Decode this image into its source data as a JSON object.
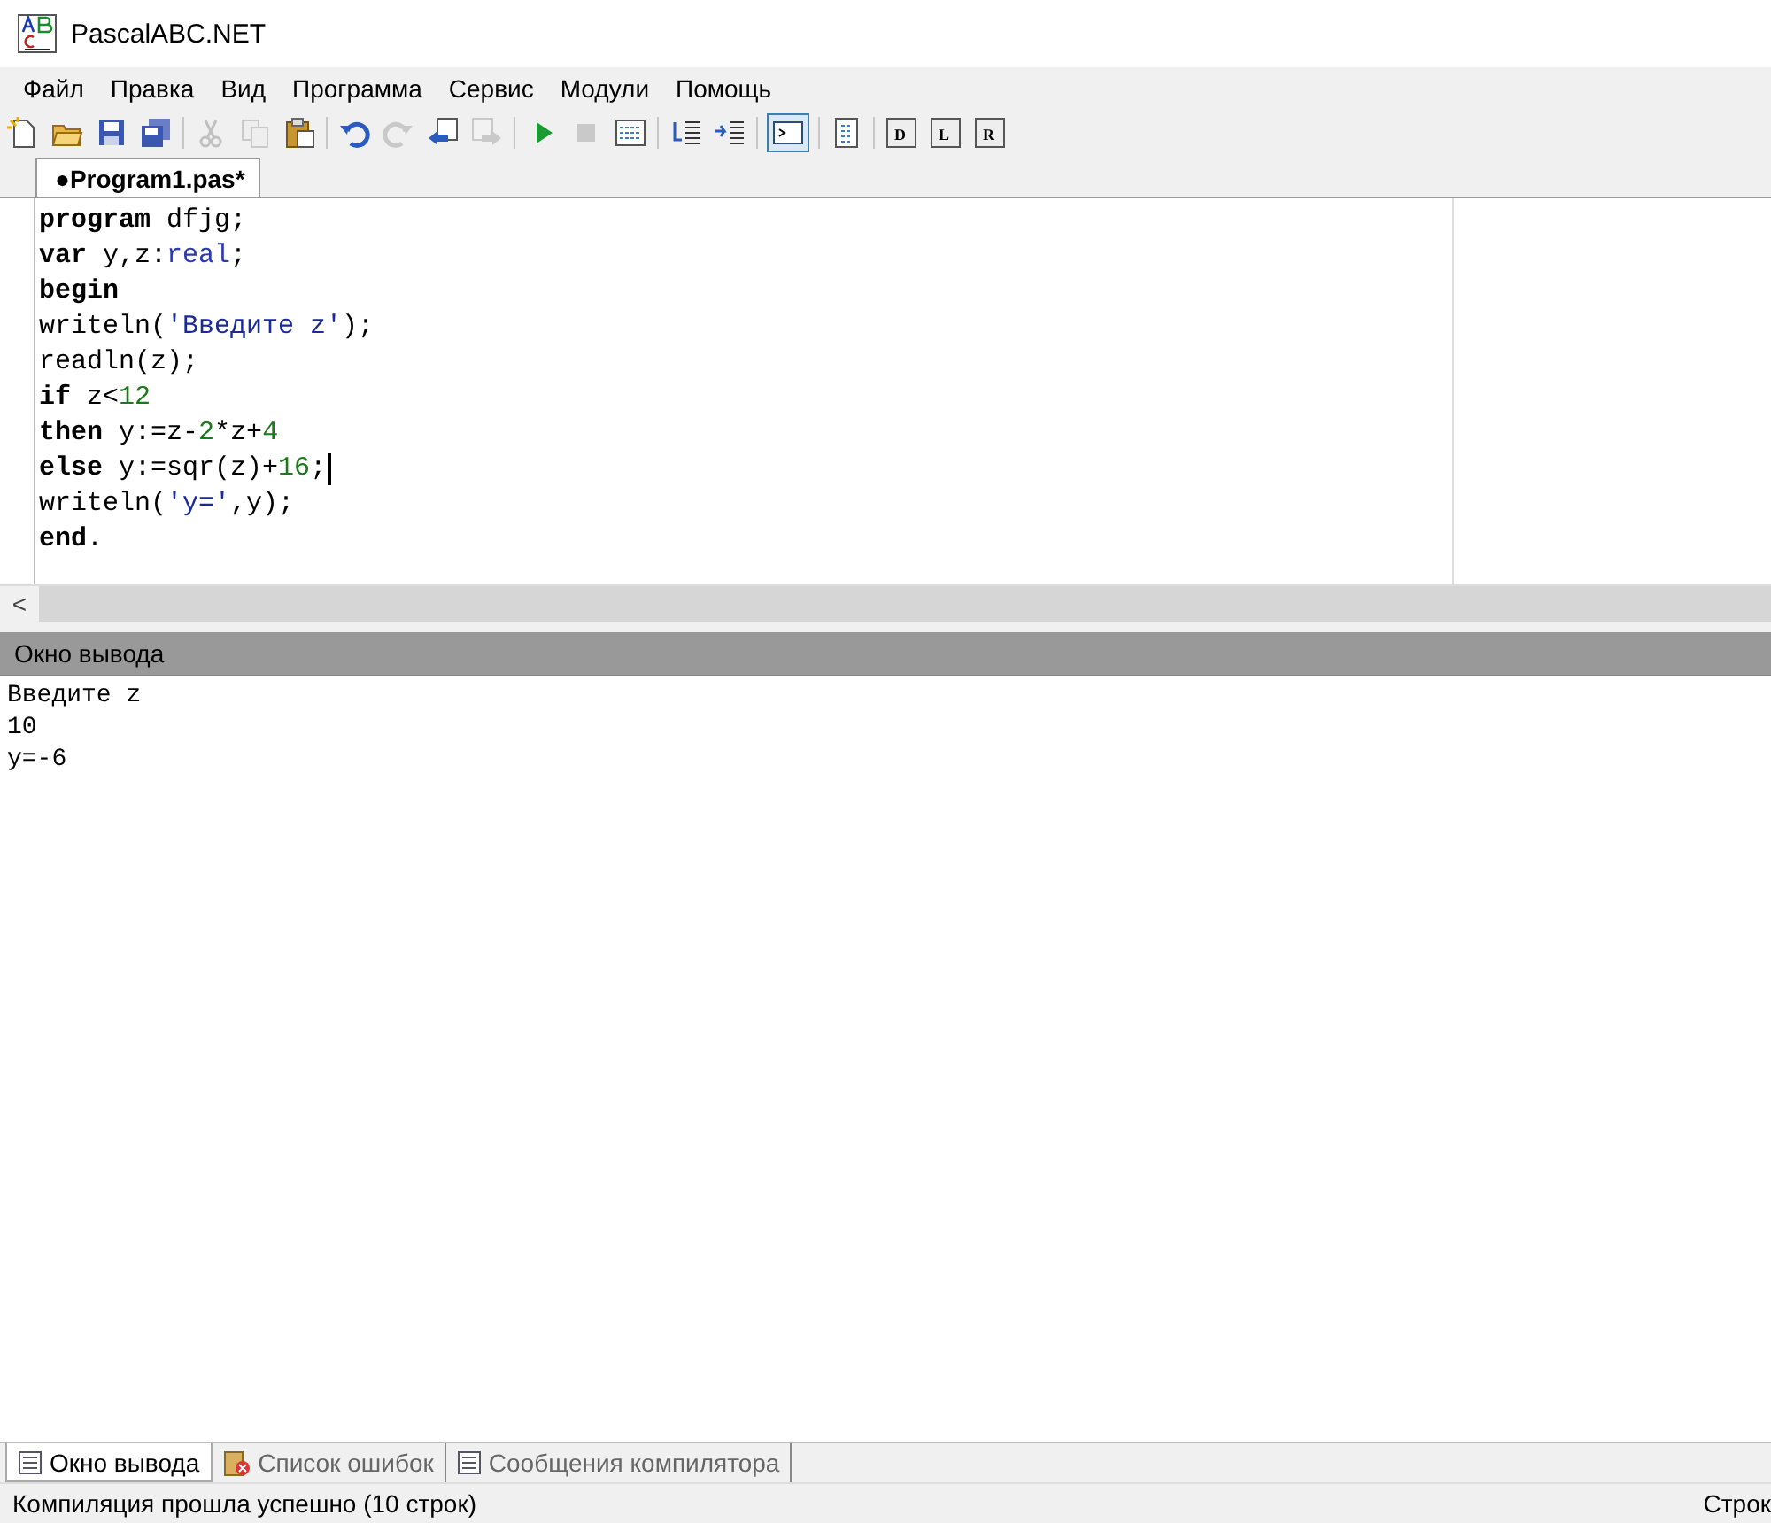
{
  "window": {
    "title": "PascalABC.NET"
  },
  "menu": [
    "Файл",
    "Правка",
    "Вид",
    "Программа",
    "Сервис",
    "Модули",
    "Помощь"
  ],
  "toolbar": [
    {
      "kind": "new",
      "disabled": false,
      "selected": false
    },
    {
      "kind": "open",
      "disabled": false,
      "selected": false
    },
    {
      "kind": "save",
      "disabled": false,
      "selected": false
    },
    {
      "kind": "saveall",
      "disabled": false,
      "selected": false
    },
    {
      "kind": "sep"
    },
    {
      "kind": "cut",
      "disabled": true,
      "selected": false
    },
    {
      "kind": "copy",
      "disabled": true,
      "selected": false
    },
    {
      "kind": "paste",
      "disabled": false,
      "selected": false
    },
    {
      "kind": "sep"
    },
    {
      "kind": "undo",
      "disabled": false,
      "selected": false
    },
    {
      "kind": "redo",
      "disabled": true,
      "selected": false
    },
    {
      "kind": "back",
      "disabled": false,
      "selected": false
    },
    {
      "kind": "forward",
      "disabled": true,
      "selected": false
    },
    {
      "kind": "sep"
    },
    {
      "kind": "run",
      "disabled": false,
      "selected": false
    },
    {
      "kind": "stop",
      "disabled": true,
      "selected": false
    },
    {
      "kind": "build",
      "disabled": false,
      "selected": false
    },
    {
      "kind": "sep"
    },
    {
      "kind": "indent",
      "disabled": false,
      "selected": false
    },
    {
      "kind": "outdent",
      "disabled": false,
      "selected": false
    },
    {
      "kind": "sep"
    },
    {
      "kind": "console",
      "disabled": false,
      "selected": true
    },
    {
      "kind": "sep"
    },
    {
      "kind": "doc",
      "disabled": false,
      "selected": false
    },
    {
      "kind": "sep"
    },
    {
      "kind": "letter",
      "label": "D",
      "disabled": false,
      "selected": false
    },
    {
      "kind": "letter",
      "label": "L",
      "disabled": false,
      "selected": false
    },
    {
      "kind": "letter",
      "label": "R",
      "disabled": false,
      "selected": false
    }
  ],
  "editor_tabs": [
    {
      "label": "●Program1.pas*",
      "selected": true
    }
  ],
  "code_lines": [
    {
      "cursor": false,
      "tokens": [
        {
          "kind": "keyword",
          "text": "program"
        },
        {
          "kind": "plain",
          "text": " dfjg;"
        }
      ]
    },
    {
      "cursor": false,
      "tokens": [
        {
          "kind": "keyword",
          "text": "var"
        },
        {
          "kind": "plain",
          "text": " y,z:"
        },
        {
          "kind": "type",
          "text": "real"
        },
        {
          "kind": "plain",
          "text": ";"
        }
      ]
    },
    {
      "cursor": false,
      "tokens": [
        {
          "kind": "keyword",
          "text": "begin"
        }
      ]
    },
    {
      "cursor": false,
      "tokens": [
        {
          "kind": "plain",
          "text": "writeln("
        },
        {
          "kind": "string",
          "text": "'Введите z'"
        },
        {
          "kind": "plain",
          "text": ");"
        }
      ]
    },
    {
      "cursor": false,
      "tokens": [
        {
          "kind": "plain",
          "text": "readln(z);"
        }
      ]
    },
    {
      "cursor": false,
      "tokens": [
        {
          "kind": "keyword",
          "text": "if"
        },
        {
          "kind": "plain",
          "text": " z<"
        },
        {
          "kind": "number",
          "text": "12"
        }
      ]
    },
    {
      "cursor": false,
      "tokens": [
        {
          "kind": "keyword",
          "text": "then"
        },
        {
          "kind": "plain",
          "text": " y:=z-"
        },
        {
          "kind": "number",
          "text": "2"
        },
        {
          "kind": "plain",
          "text": "*z+"
        },
        {
          "kind": "number",
          "text": "4"
        }
      ]
    },
    {
      "cursor": true,
      "tokens": [
        {
          "kind": "keyword",
          "text": "else"
        },
        {
          "kind": "plain",
          "text": " y:=sqr(z)+"
        },
        {
          "kind": "number",
          "text": "16"
        },
        {
          "kind": "plain",
          "text": ";"
        }
      ]
    },
    {
      "cursor": false,
      "tokens": [
        {
          "kind": "plain",
          "text": "writeln("
        },
        {
          "kind": "string",
          "text": "'y='"
        },
        {
          "kind": "plain",
          "text": ",y);"
        }
      ]
    },
    {
      "cursor": false,
      "tokens": [
        {
          "kind": "keyword",
          "text": "end"
        },
        {
          "kind": "plain",
          "text": "."
        }
      ]
    }
  ],
  "scroll_left": "<",
  "output": {
    "title": "Окно вывода",
    "lines": [
      "Введите z",
      "10",
      "y=-6"
    ]
  },
  "bottom_tabs": [
    {
      "label": "Окно вывода",
      "kind": "output",
      "selected": true
    },
    {
      "label": "Список ошибок",
      "kind": "errors",
      "selected": false
    },
    {
      "label": "Сообщения компилятора",
      "kind": "messages",
      "selected": false
    }
  ],
  "status_bar": {
    "message": "Компиляция прошла успешно (10 строк)",
    "position": "Строк"
  }
}
